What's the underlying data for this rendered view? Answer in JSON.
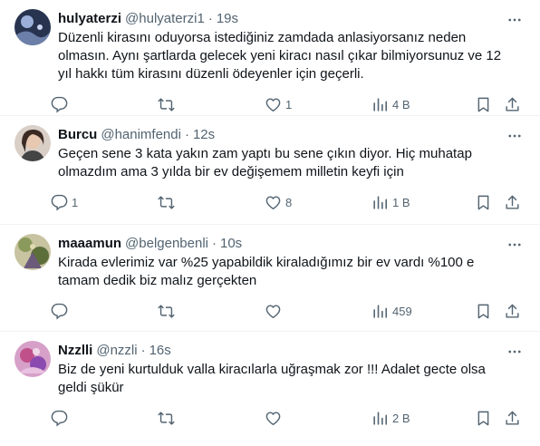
{
  "tweets": [
    {
      "name": "hulyaterzi",
      "handle": "@hulyaterzi1",
      "time": "19s",
      "text": "Düzenli kirasını oduyorsa istediğiniz zamdada anlasiyorsanız neden olmasın. Aynı şartlarda gelecek yeni kiracı nasıl çıkar bilmiyorsunuz ve 12 yıl hakkı tüm kirasını düzenli ödeyenler için geçerli.",
      "replies": "",
      "retweets": "",
      "likes": "1",
      "views": "4 B",
      "avatar_color": "#3a4a6b"
    },
    {
      "name": "Burcu",
      "handle": "@hanimfendi",
      "time": "12s",
      "text": "Geçen sene 3 kata yakın zam yaptı bu sene çıkın diyor. Hiç muhatap olmazdım ama 3 yılda bir ev değişemem milletin keyfi için",
      "replies": "1",
      "retweets": "",
      "likes": "8",
      "views": "1 B",
      "avatar_color": "#5a4a44"
    },
    {
      "name": "maaamun",
      "handle": "@belgenbenli",
      "time": "10s",
      "text": "Kirada evlerimiz var %25 yapabildik kiraladığımız bir ev vardı %100 e tamam dedik biz malız gerçekten",
      "replies": "",
      "retweets": "",
      "likes": "",
      "views": "459",
      "avatar_color": "#7a8a55"
    },
    {
      "name": "Nzzlli",
      "handle": "@nzzli",
      "time": "16s",
      "text": "Biz de yeni kurtulduk valla kiracılarla uğraşmak zor !!! Adalet gecte olsa geldi şükür",
      "replies": "",
      "retweets": "",
      "likes": "",
      "views": "2 B",
      "avatar_color": "#b86a9a"
    }
  ],
  "colors": {
    "text": "#0f1419",
    "secondary": "#536471",
    "border": "#eff3f4"
  }
}
